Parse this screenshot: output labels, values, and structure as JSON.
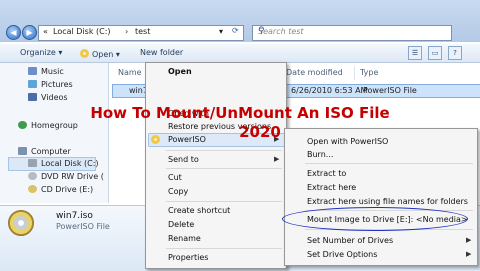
{
  "address_bar": {
    "root": "«",
    "segment1": "Local Disk (C:)",
    "separator": "›",
    "segment2": "test",
    "dropdown": "▾"
  },
  "search": {
    "placeholder": "Search test"
  },
  "toolbar": {
    "organize": "Organize ▾",
    "open": "Open ▾",
    "new_folder": "New folder"
  },
  "sidebar": {
    "items": [
      {
        "label": "Music",
        "icon": "music-icon"
      },
      {
        "label": "Pictures",
        "icon": "pictures-icon"
      },
      {
        "label": "Videos",
        "icon": "videos-icon"
      },
      {
        "label": "Homegroup",
        "icon": "homegroup-icon"
      },
      {
        "label": "Computer",
        "icon": "computer-icon"
      },
      {
        "label": "Local Disk (C:)",
        "icon": "disk-icon"
      },
      {
        "label": "DVD RW Drive (",
        "icon": "dvd-icon"
      },
      {
        "label": "CD Drive (E:)",
        "icon": "cd-icon"
      }
    ]
  },
  "columns": {
    "name": "Name",
    "date": "Date modified",
    "type": "Type"
  },
  "file": {
    "name": "win7.iso",
    "date": "6/26/2010 6:53 AM",
    "type": "PowerISO File"
  },
  "details": {
    "title": "win7.iso",
    "subtitle": "PowerISO File"
  },
  "context_menu": {
    "items": [
      "Open",
      "Open with",
      "Restore previous versions",
      "PowerISO",
      "Send to",
      "Cut",
      "Copy",
      "Create shortcut",
      "Delete",
      "Rename",
      "Properties"
    ]
  },
  "submenu": {
    "items": [
      "Open with PowerISO",
      "Burn...",
      "Extract to",
      "Extract here",
      "Extract here using file names for folders",
      "Mount Image to Drive [E:]: <No media>",
      "Set Number of Drives",
      "Set Drive Options"
    ]
  },
  "overlay": {
    "line1": "How To Mount/UnMount An ISO File",
    "line2": "2020"
  },
  "colors": {
    "title_red": "#c40000",
    "highlight_blue": "#1f2fc2",
    "selection": "#cde3fb"
  }
}
